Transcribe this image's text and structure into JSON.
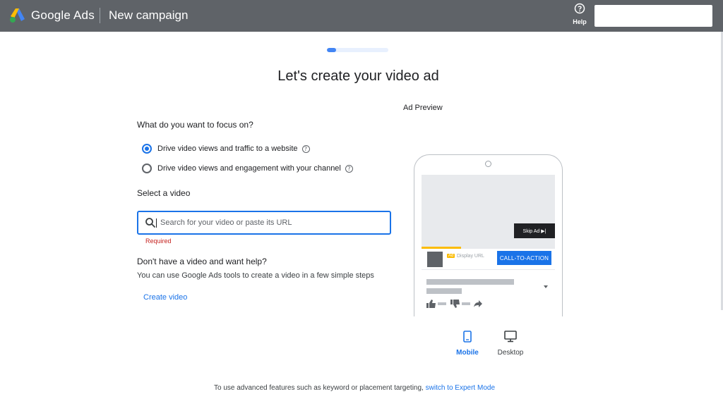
{
  "header": {
    "brand": "Google Ads",
    "page_name": "New campaign",
    "help_label": "Help"
  },
  "progress": {
    "fraction": 0.15
  },
  "title": "Let's create your video ad",
  "focus": {
    "question": "What do you want to focus on?",
    "options": [
      {
        "label": "Drive video views and traffic to a website",
        "selected": true
      },
      {
        "label": "Drive video views and engagement with your channel",
        "selected": false
      }
    ]
  },
  "video": {
    "label": "Select a video",
    "placeholder": "Search for your video or paste its URL",
    "error": "Required"
  },
  "help": {
    "heading": "Don't have a video and want help?",
    "text": "You can use Google Ads tools to create a video in a few simple steps",
    "link": "Create video"
  },
  "preview": {
    "label": "Ad Preview",
    "skip_label": "Skip Ad ▶|",
    "ad_badge": "Ad",
    "display_url": "Display URL",
    "cta": "CALL-TO-ACTION",
    "devices": [
      {
        "label": "Mobile",
        "icon": "phone-icon",
        "active": true
      },
      {
        "label": "Desktop",
        "icon": "monitor-icon",
        "active": false
      }
    ]
  },
  "footer": {
    "text": "To use advanced features such as keyword or placement targeting, ",
    "link": "switch to Expert Mode"
  },
  "colors": {
    "header_bg": "#5f6368",
    "accent": "#1a73e8",
    "error": "#c5221f",
    "ad_yellow": "#fbbc04"
  }
}
